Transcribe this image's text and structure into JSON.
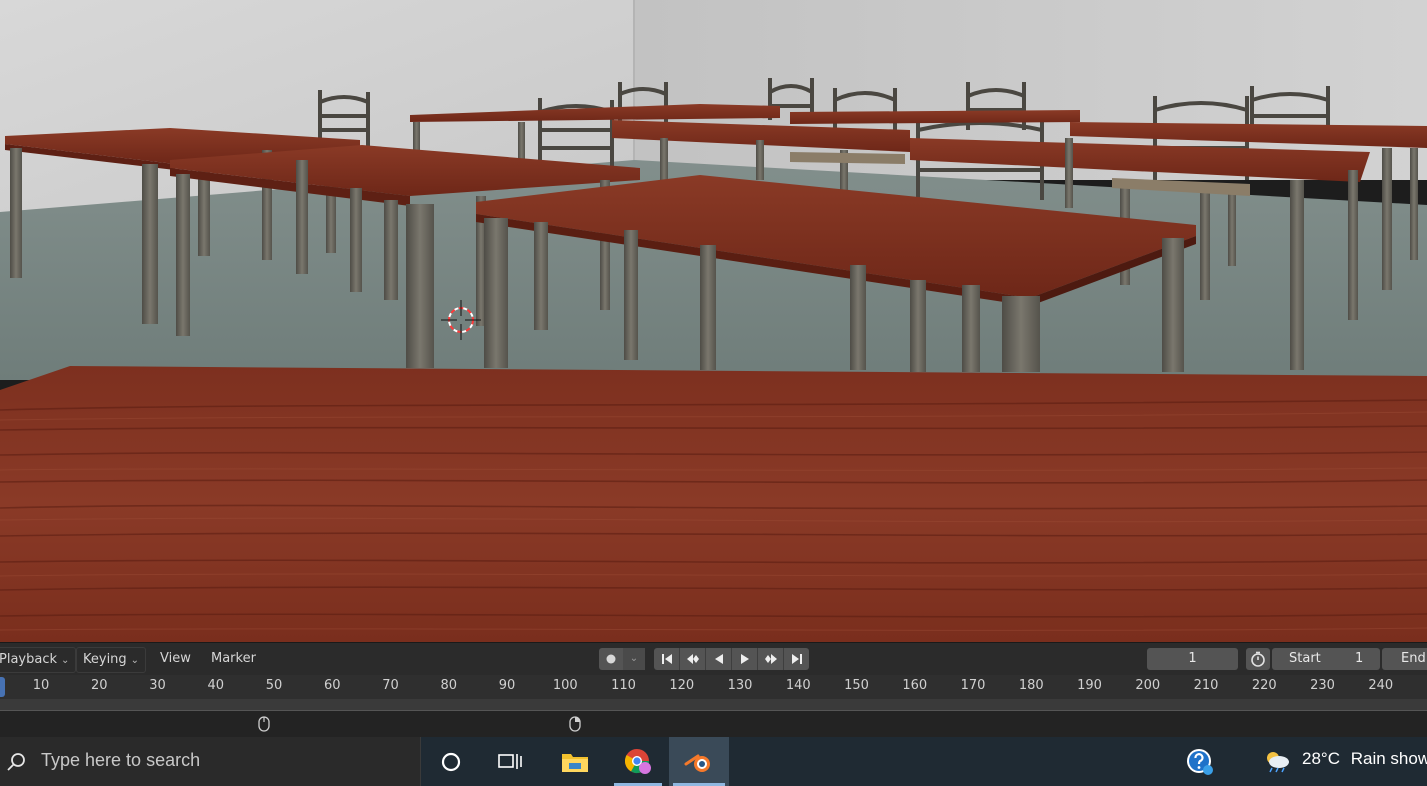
{
  "timeline": {
    "menus": {
      "playback": "Playback",
      "keying": "Keying",
      "view": "View",
      "marker": "Marker"
    },
    "current_frame": "1",
    "start_label": "Start",
    "start_value": "1",
    "end_label": "End",
    "ruler_ticks": [
      "10",
      "20",
      "30",
      "40",
      "50",
      "60",
      "70",
      "80",
      "90",
      "100",
      "110",
      "120",
      "130",
      "140",
      "150",
      "160",
      "170",
      "180",
      "190",
      "200",
      "210",
      "220",
      "230",
      "240"
    ]
  },
  "taskbar": {
    "search_placeholder": "Type here to search",
    "weather_temp": "28°C",
    "weather_text": "Rain show"
  },
  "colors": {
    "accent_blue": "#4772b3",
    "table_wood": "#7a2a1c",
    "taskbar_bg": "#1f2a33"
  }
}
